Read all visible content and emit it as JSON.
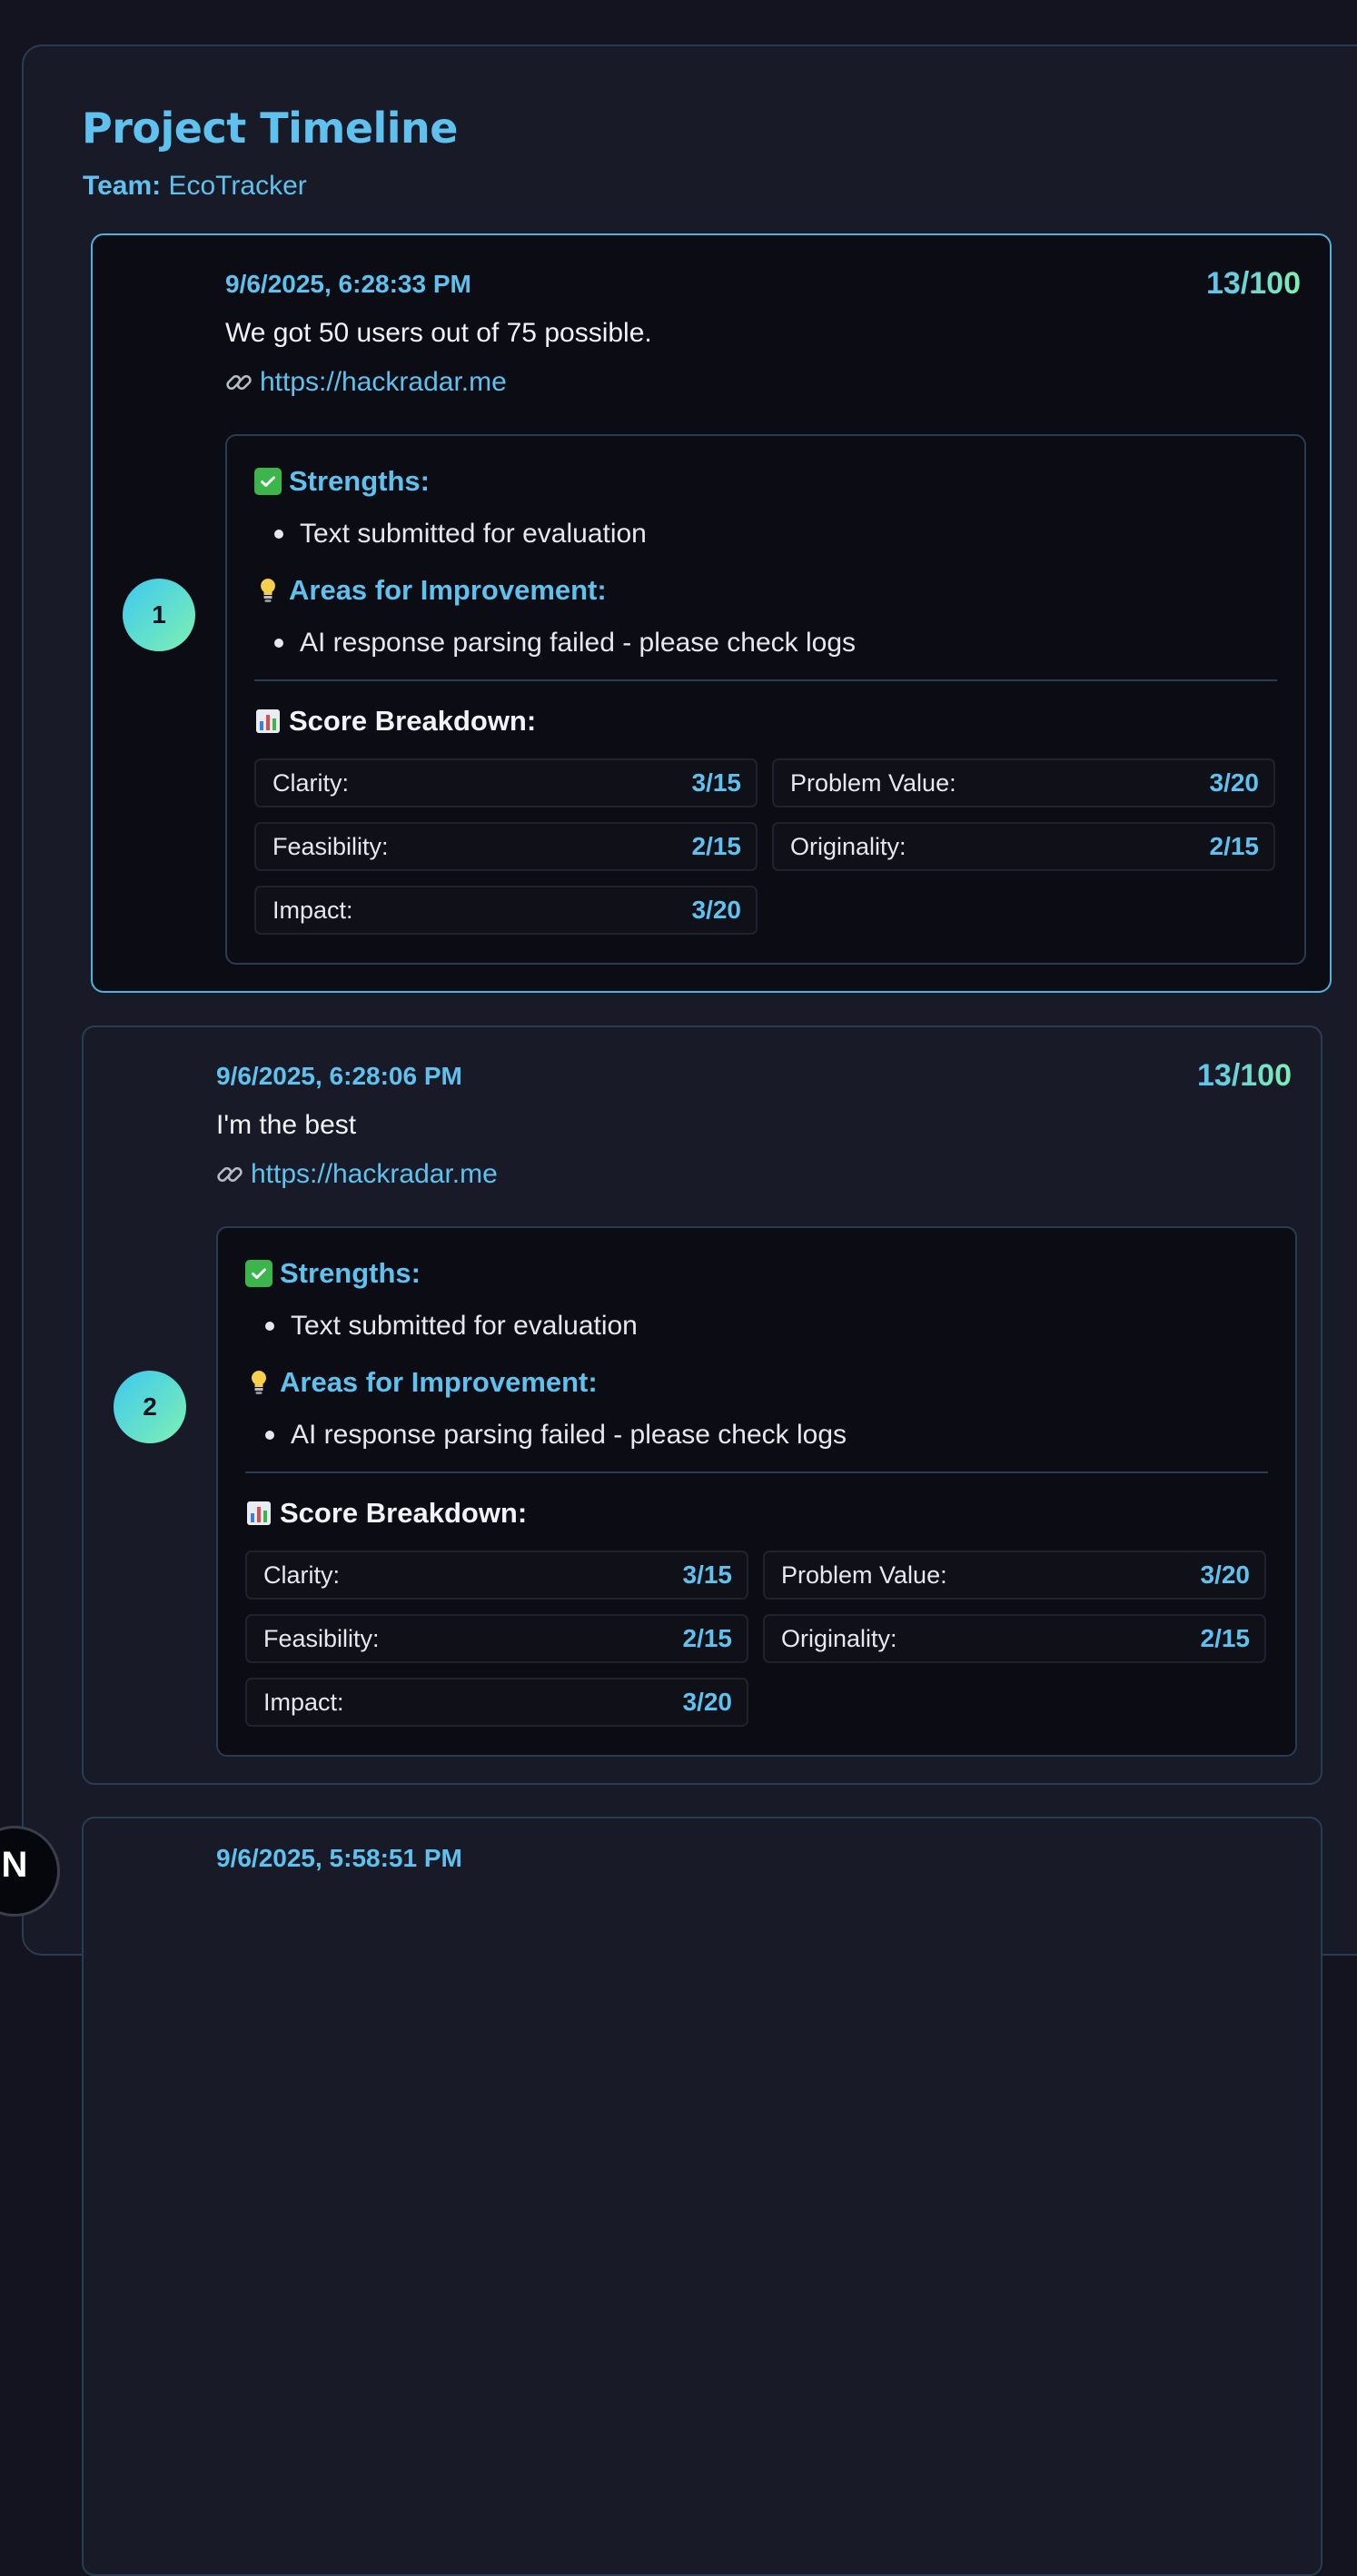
{
  "header": {
    "title": "Project Timeline",
    "team_label": "Team:",
    "team_name": "EcoTracker"
  },
  "entries": [
    {
      "index": "1",
      "timestamp": "9/6/2025, 6:28:33 PM",
      "score": "13/100",
      "message": "We got 50 users out of 75 possible.",
      "link": "https://hackradar.me",
      "strengths_heading": "Strengths:",
      "strengths": [
        "Text submitted for evaluation"
      ],
      "improvements_heading": "Areas for Improvement:",
      "improvements": [
        "AI response parsing failed - please check logs"
      ],
      "breakdown_heading": "Score Breakdown:",
      "metrics": [
        {
          "label": "Clarity:",
          "value": "3/15"
        },
        {
          "label": "Problem Value:",
          "value": "3/20"
        },
        {
          "label": "Feasibility:",
          "value": "2/15"
        },
        {
          "label": "Originality:",
          "value": "2/15"
        },
        {
          "label": "Impact:",
          "value": "3/20"
        }
      ]
    },
    {
      "index": "2",
      "timestamp": "9/6/2025, 6:28:06 PM",
      "score": "13/100",
      "message": "I'm the best",
      "link": "https://hackradar.me",
      "strengths_heading": "Strengths:",
      "strengths": [
        "Text submitted for evaluation"
      ],
      "improvements_heading": "Areas for Improvement:",
      "improvements": [
        "AI response parsing failed - please check logs"
      ],
      "breakdown_heading": "Score Breakdown:",
      "metrics": [
        {
          "label": "Clarity:",
          "value": "3/15"
        },
        {
          "label": "Problem Value:",
          "value": "3/20"
        },
        {
          "label": "Feasibility:",
          "value": "2/15"
        },
        {
          "label": "Originality:",
          "value": "2/15"
        },
        {
          "label": "Impact:",
          "value": "3/20"
        }
      ]
    },
    {
      "timestamp": "9/6/2025, 5:58:51 PM"
    }
  ],
  "corner_avatar": "N",
  "colors": {
    "accent": "#5ec1ee",
    "score_gradient_end": "#7df0b3",
    "background": "#13141f"
  }
}
